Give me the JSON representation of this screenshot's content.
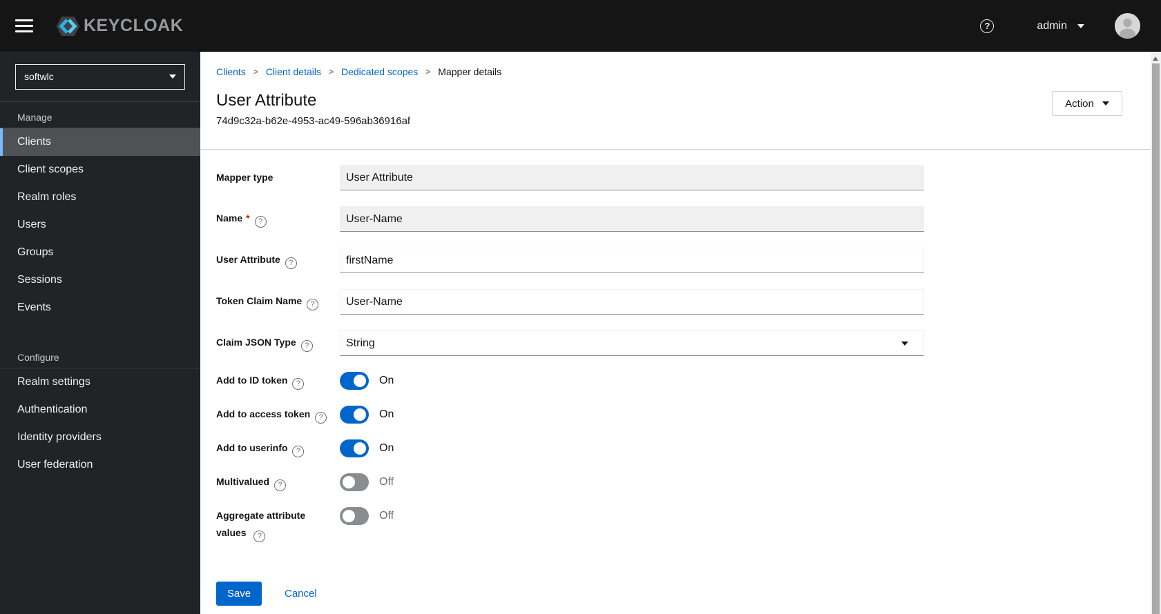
{
  "header": {
    "brand": "KEYCLOAK",
    "username": "admin"
  },
  "sidebar": {
    "realm": "softwlc",
    "manage": {
      "label": "Manage",
      "items": [
        "Clients",
        "Client scopes",
        "Realm roles",
        "Users",
        "Groups",
        "Sessions",
        "Events"
      ]
    },
    "configure": {
      "label": "Configure",
      "items": [
        "Realm settings",
        "Authentication",
        "Identity providers",
        "User federation"
      ]
    },
    "active_item": "Clients"
  },
  "breadcrumb": {
    "items": [
      "Clients",
      "Client details",
      "Dedicated scopes",
      "Mapper details"
    ]
  },
  "page": {
    "title": "User Attribute",
    "subtitle": "74d9c32a-b62e-4953-ac49-596ab36916af",
    "action_label": "Action"
  },
  "form": {
    "mapper_type": {
      "label": "Mapper type",
      "value": "User Attribute",
      "disabled": true
    },
    "name": {
      "label": "Name",
      "required_marker": "*",
      "value": "User-Name",
      "disabled": true
    },
    "user_attribute": {
      "label": "User Attribute",
      "value": "firstName"
    },
    "token_claim_name": {
      "label": "Token Claim Name",
      "value": "User-Name"
    },
    "claim_json_type": {
      "label": "Claim JSON Type",
      "value": "String"
    },
    "add_to_id_token": {
      "label": "Add to ID token",
      "state": "On",
      "on": true
    },
    "add_to_access_token": {
      "label": "Add to access token",
      "state": "On",
      "on": true
    },
    "add_to_userinfo": {
      "label": "Add to userinfo",
      "state": "On",
      "on": true
    },
    "multivalued": {
      "label": "Multivalued",
      "state": "Off",
      "on": false
    },
    "aggregate_attribute_values": {
      "label": "Aggregate attribute values",
      "state": "Off",
      "on": false
    },
    "save_label": "Save",
    "cancel_label": "Cancel"
  },
  "colors": {
    "accent": "#0066cc",
    "link": "#0066cc",
    "switch_on": "#0066cc",
    "switch_off": "#8a8d90",
    "required": "#c9190b",
    "nav_current_indicator": "#73bcf7",
    "masthead_bg": "#151515",
    "sidebar_bg": "#212427"
  }
}
